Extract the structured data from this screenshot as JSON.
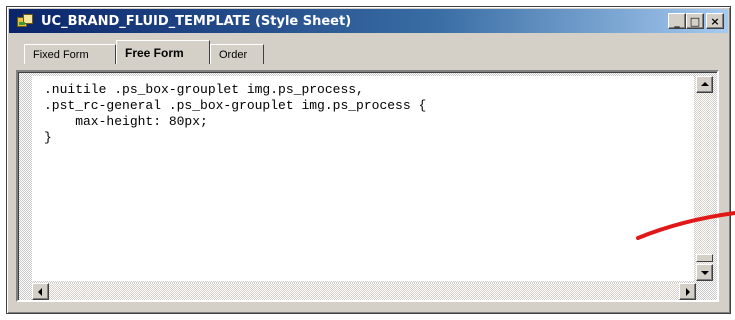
{
  "window": {
    "title": "UC_BRAND_FLUID_TEMPLATE (Style Sheet)",
    "buttons": {
      "minimize": "_",
      "maximize": "□",
      "close": "×"
    }
  },
  "tabs": [
    {
      "label": "Fixed Form",
      "active": false
    },
    {
      "label": "Free Form",
      "active": true
    },
    {
      "label": "Order",
      "active": false
    }
  ],
  "editor": {
    "code": ".nuitile .ps_box-grouplet img.ps_process,\n.pst_rc-general .ps_box-grouplet img.ps_process {\n    max-height: 80px;\n}"
  },
  "colors": {
    "titlebar_start": "#0a246a",
    "titlebar_end": "#a6caf0",
    "annotation": "#e01818"
  },
  "icons": {
    "app": "stylesheet-icon",
    "scroll_up": "arrow-up-icon",
    "scroll_down": "arrow-down-icon",
    "scroll_left": "arrow-left-icon",
    "scroll_right": "arrow-right-icon"
  }
}
